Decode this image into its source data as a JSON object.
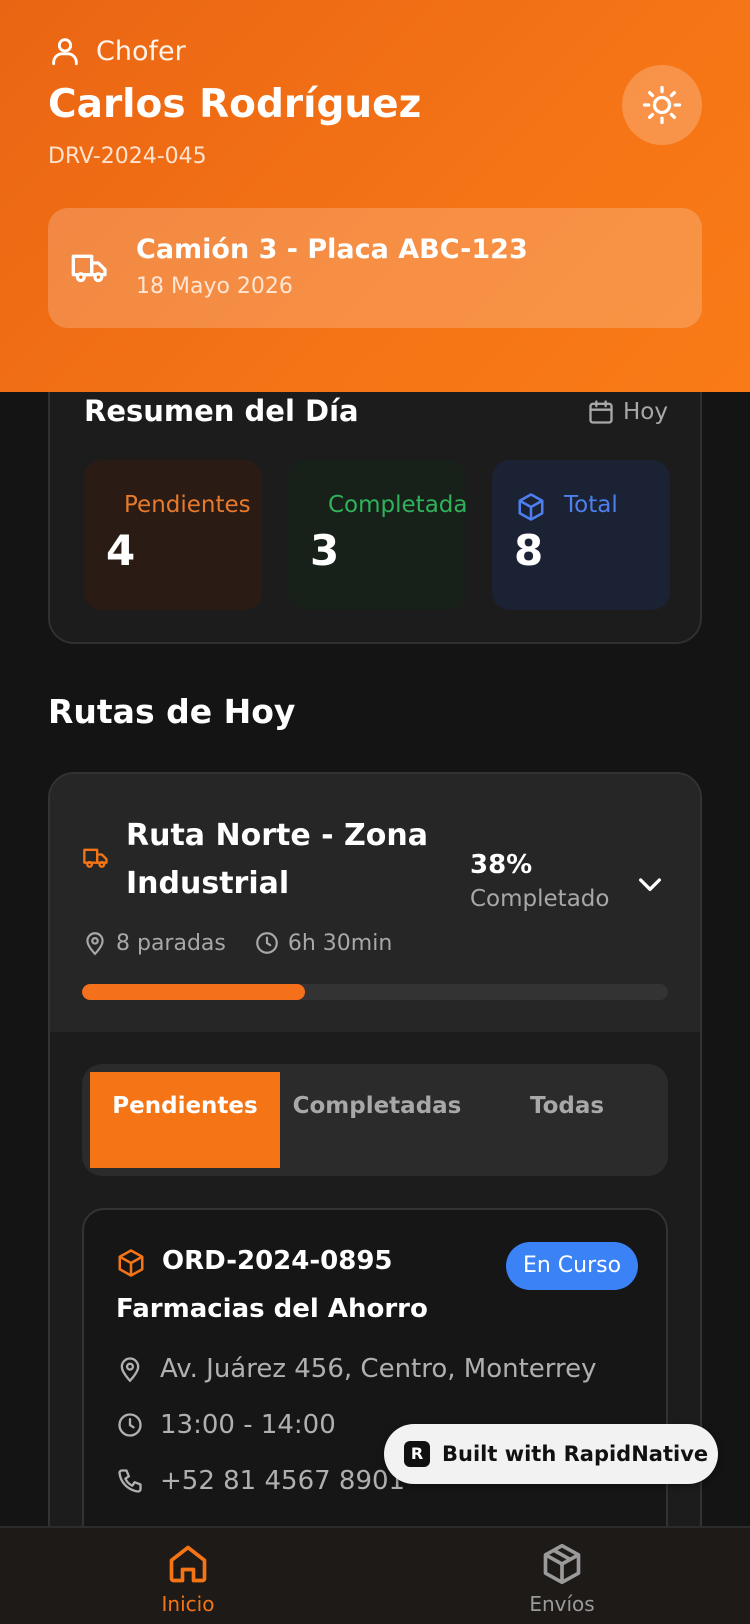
{
  "header": {
    "role": "Chofer",
    "driver_name": "Carlos Rodríguez",
    "driver_id": "DRV-2024-045",
    "vehicle": "Camión 3 - Placa ABC-123",
    "date": "18 Mayo 2026"
  },
  "summary": {
    "title": "Resumen del Día",
    "period": "Hoy",
    "stats": [
      {
        "label": "Pendientes",
        "value": "4",
        "color": "#e87a2c"
      },
      {
        "label": "Completadas",
        "value": "3",
        "color": "#2fb35a"
      },
      {
        "label": "Total",
        "value": "8",
        "color": "#4d7ff0"
      }
    ]
  },
  "routes": {
    "title": "Rutas de Hoy",
    "route": {
      "name": "Ruta Norte - Zona Industrial",
      "percent": "38%",
      "percent_label": "Completado",
      "progress": 0.38,
      "stops": "8 paradas",
      "duration": "6h 30min"
    },
    "tabs": [
      "Pendientes",
      "Completadas",
      "Todas"
    ],
    "order": {
      "id": "ORD-2024-0895",
      "client": "Farmacias del Ahorro",
      "status": "En Curso",
      "address": "Av. Juárez 456, Centro, Monterrey",
      "time_window": "13:00 - 14:00",
      "phone": "+52 81 4567 8901"
    }
  },
  "badge": {
    "text": "Built with RapidNative"
  },
  "nav": {
    "home": "Inicio",
    "shipments": "Envíos"
  },
  "colors": {
    "accent": "#f57416",
    "status_blue": "#3b82f6"
  }
}
